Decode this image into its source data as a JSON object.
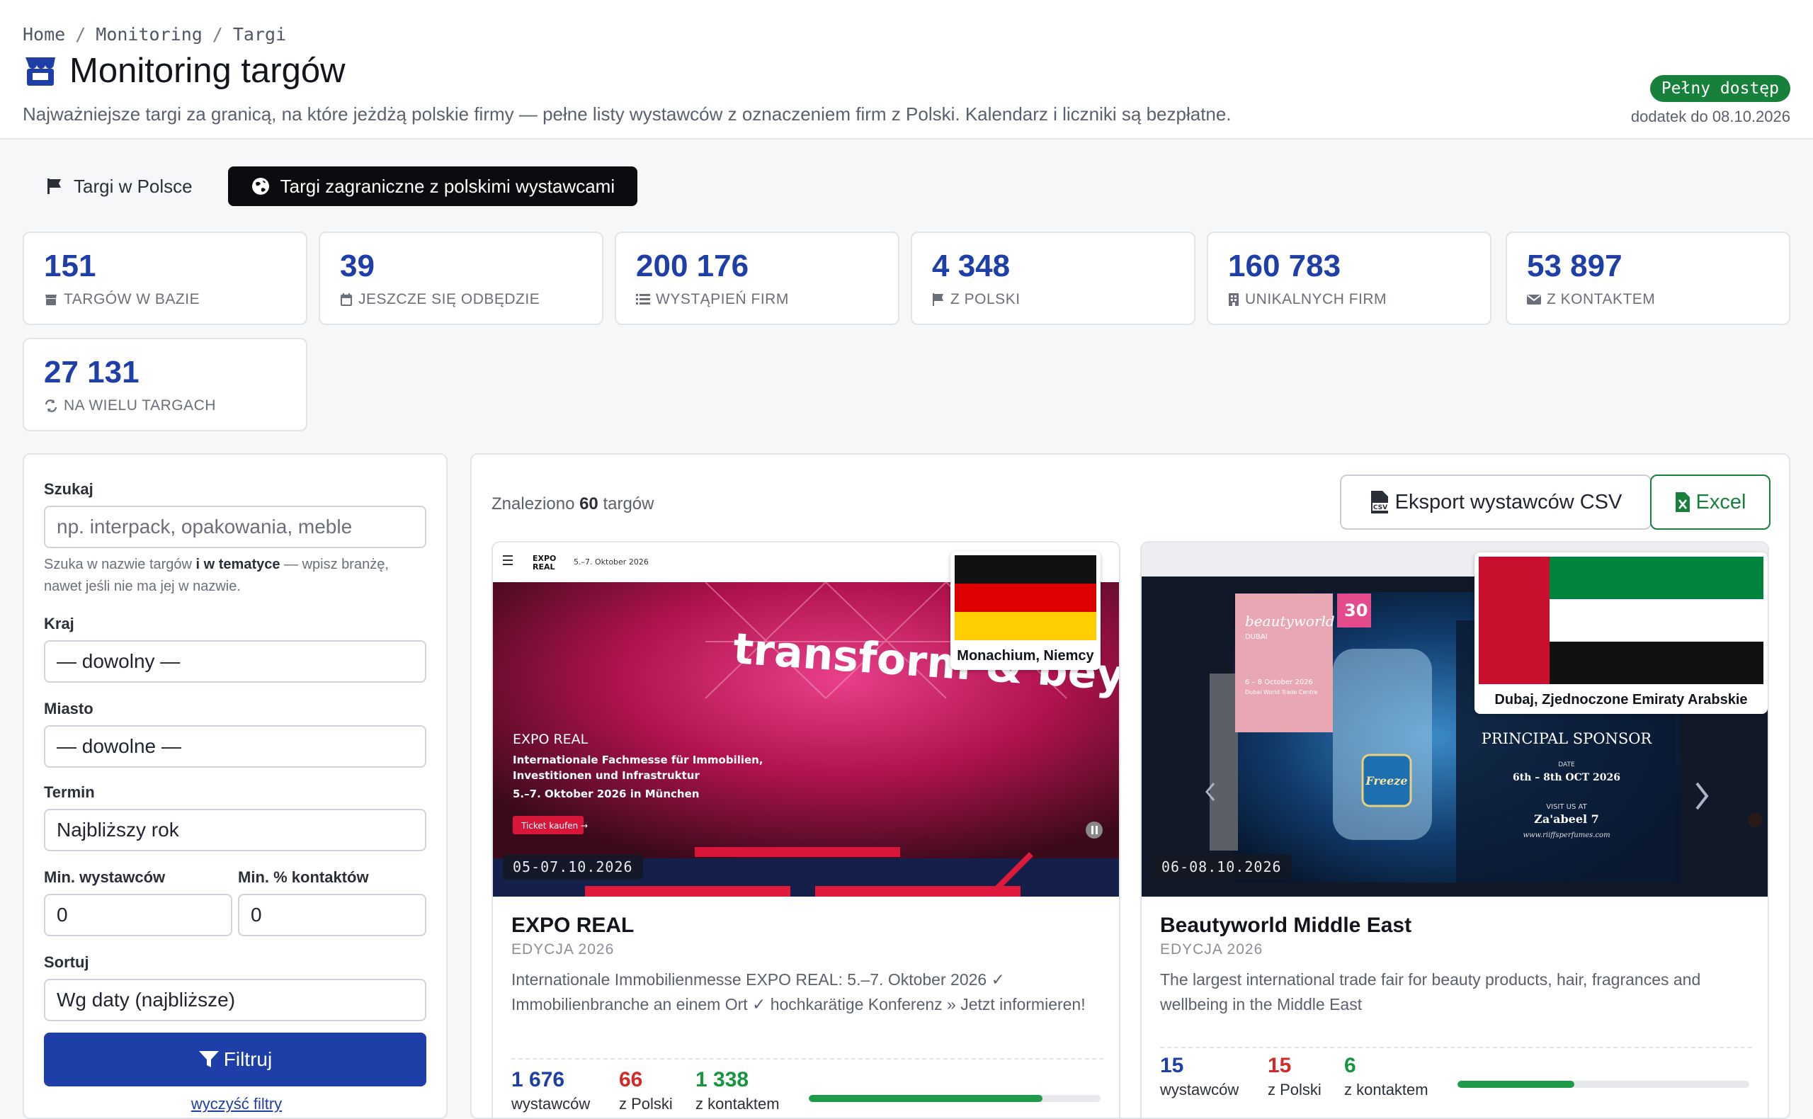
{
  "breadcrumb": [
    "Home",
    "Monitoring",
    "Targi"
  ],
  "header": {
    "title": "Monitoring targów",
    "subtitle": "Najważniejsze targi za granicą, na które jeżdżą polskie firmy — pełne listy wystawców z oznaczeniem firm z Polski. Kalendarz i liczniki są bezpłatne.",
    "access_badge": "Pełny dostęp",
    "access_date": "dodatek do 08.10.2026"
  },
  "tabs": [
    {
      "label": "Targi w Polsce",
      "icon": "flag-icon",
      "active": false
    },
    {
      "label": "Targi zagraniczne z polskimi wystawcami",
      "icon": "globe-icon",
      "active": true
    }
  ],
  "stats": [
    {
      "value": "151",
      "label": "TARGÓW W BAZIE",
      "icon": "store-icon"
    },
    {
      "value": "39",
      "label": "JESZCZE SIĘ ODBĘDZIE",
      "icon": "calendar-icon"
    },
    {
      "value": "200 176",
      "label": "WYSTĄPIEŃ FIRM",
      "icon": "list-icon"
    },
    {
      "value": "4 348",
      "label": "Z POLSKI",
      "icon": "flag-icon"
    },
    {
      "value": "160 783",
      "label": "UNIKALNYCH FIRM",
      "icon": "building-icon"
    },
    {
      "value": "53 897",
      "label": "Z KONTAKTEM",
      "icon": "envelope-icon"
    },
    {
      "value": "27 131",
      "label": "NA WIELU TARGACH",
      "icon": "repeat-icon"
    }
  ],
  "filters": {
    "search_label": "Szukaj",
    "search_placeholder": "np. interpack, opakowania, meble",
    "hint_pre": "Szuka w nazwie targów ",
    "hint_bold": "i w tematyce",
    "hint_post": " — wpisz branżę, nawet jeśli nie ma jej w nazwie.",
    "country_label": "Kraj",
    "country_value": "— dowolny —",
    "city_label": "Miasto",
    "city_value": "— dowolne —",
    "term_label": "Termin",
    "term_value": "Najbliższy rok",
    "min_exhibitors_label": "Min. wystawców",
    "min_exhibitors_value": "0",
    "min_contacts_label": "Min. % kontaktów",
    "min_contacts_value": "0",
    "sort_label": "Sortuj",
    "sort_value": "Wg daty (najbliższe)",
    "filter_button": "Filtruj",
    "clear_link": "wyczyść filtry"
  },
  "results": {
    "found_pre": "Znaleziono ",
    "found_count": "60",
    "found_post": " targów",
    "export_csv": "Eksport wystawców CSV",
    "export_excel": "Excel"
  },
  "cards": [
    {
      "name": "EXPO REAL",
      "edition": "EDYCJA 2026",
      "date": "05-07.10.2026",
      "location": "Monachium, Niemcy",
      "description": "Internationale Immobilienmesse EXPO REAL: 5.–7. Oktober 2026 ✓ Immobilienbranche an einem Ort ✓ hochkarätige Konferenz » Jetzt informieren!",
      "exhibitors": "1 676",
      "exhibitors_label": "wystawców",
      "poland": "66",
      "poland_label": "z Polski",
      "contacts": "1 338",
      "contacts_label": "z kontaktem",
      "contact_ratio": 0.8,
      "screenshot": {
        "nav_date": "5.–7. Oktober 2026",
        "logo": "EXPO REAL",
        "headline": "transform & beyond",
        "event": "EXPO REAL",
        "tagline1": "Internationale Fachmesse für Immobilien,",
        "tagline2": "Investitionen und Infrastruktur",
        "tagline3": "5.–7. Oktober 2026 in München",
        "cta": "Ticket kaufen →"
      }
    },
    {
      "name": "Beautyworld Middle East",
      "edition": "EDYCJA 2026",
      "date": "06-08.10.2026",
      "location": "Dubaj, Zjednoczone Emiraty Arabskie",
      "description": "The largest international trade fair for beauty products, hair, fragrances and wellbeing in the Middle East",
      "exhibitors": "15",
      "exhibitors_label": "wystawców",
      "poland": "15",
      "poland_label": "z Polski",
      "contacts": "6",
      "contacts_label": "z kontaktem",
      "contact_ratio": 0.4,
      "screenshot": {
        "brand": "beautyworld",
        "brand_sub": "DUBAI",
        "badge": "30",
        "dates": "6 – 8 October 2026",
        "venue": "Dubai World Trade Centre",
        "sponsor": "PRINCIPAL SPONSOR",
        "perfume": "Freeze",
        "date_label": "DATE",
        "date_range": "6th – 8th OCT 2026",
        "visit": "VISIT US AT",
        "booth": "Za'abeel 7",
        "url": "www.riiffsperfumes.com"
      }
    }
  ],
  "colors": {
    "accent": "#1e3ea8",
    "success": "#17803a",
    "danger": "#d42a2a",
    "green_metric": "#17943e"
  }
}
